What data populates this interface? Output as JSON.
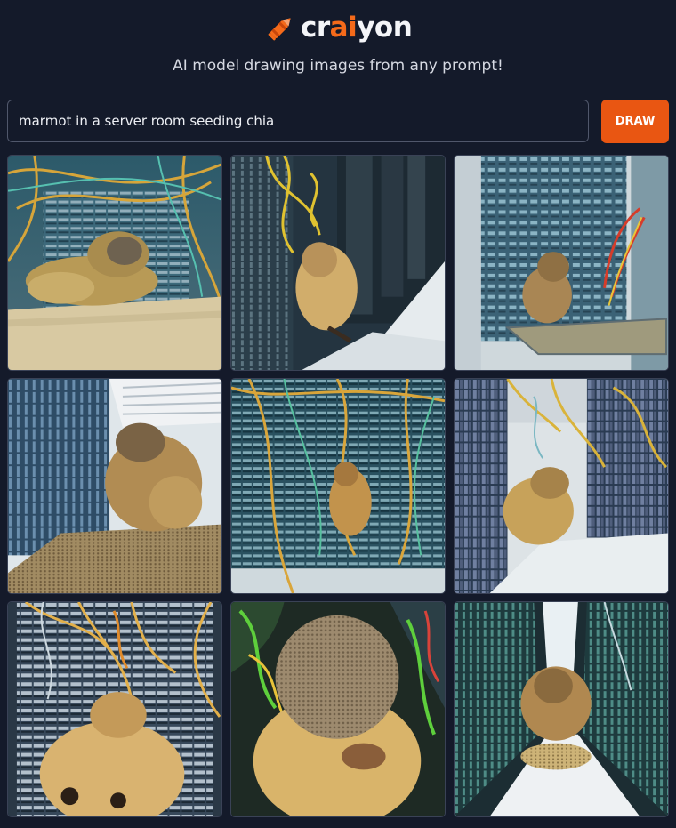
{
  "brand": {
    "name_parts": [
      "cr",
      "ai",
      "yon"
    ],
    "accent_color": "#f56a1a",
    "logo_icon": "crayon-icon"
  },
  "tagline": "AI model drawing images from any prompt!",
  "prompt": {
    "value": "marmot in a server room seeding chia"
  },
  "draw_button": {
    "label": "DRAW",
    "color": "#e95612"
  },
  "results": {
    "count": 9,
    "subject": "marmot-in-server-room-image"
  }
}
